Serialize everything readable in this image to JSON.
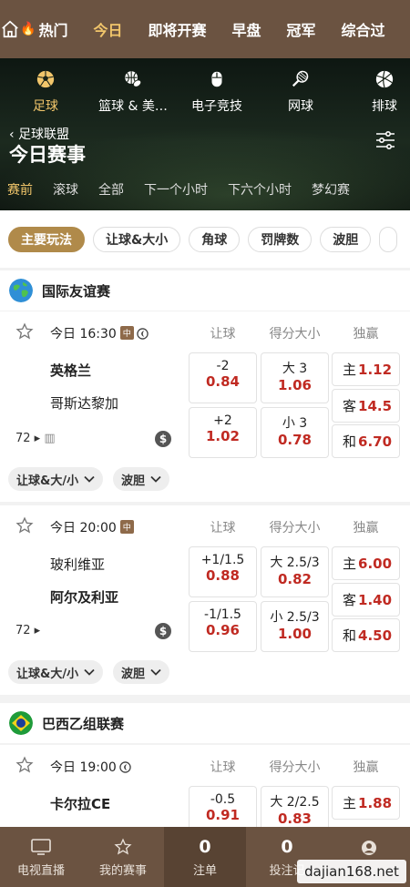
{
  "topnav": {
    "tabs": [
      "热门",
      "今日",
      "即将开赛",
      "早盘",
      "冠军",
      "综合过"
    ]
  },
  "sports": [
    {
      "label": "足球",
      "icon": "soccer-icon"
    },
    {
      "label": "篮球 & 美…",
      "icon": "basketball-icon"
    },
    {
      "label": "电子竞技",
      "icon": "esports-icon"
    },
    {
      "label": "网球",
      "icon": "tennis-icon"
    },
    {
      "label": "排球",
      "icon": "volleyball-icon"
    }
  ],
  "breadcrumb": "足球联盟",
  "page_title": "今日赛事",
  "subtabs": [
    "赛前",
    "滚球",
    "全部",
    "下一个小时",
    "下六个小时",
    "梦幻赛"
  ],
  "chips": [
    "主要玩法",
    "让球&大小",
    "角球",
    "罚牌数",
    "波胆"
  ],
  "columns": {
    "handicap": "让球",
    "totals": "得分大小",
    "winner": "独赢"
  },
  "leagues": [
    {
      "name": "国际友谊赛"
    },
    {
      "name": "巴西乙组联赛"
    }
  ],
  "matches": [
    {
      "time": "今日 16:30",
      "tag": "中",
      "home": "英格兰",
      "away": "哥斯达黎加",
      "more": "72",
      "handicap": [
        {
          "line": "-2",
          "odds": "0.84"
        },
        {
          "line": "+2",
          "odds": "1.02"
        }
      ],
      "totals": [
        {
          "line": "大 3",
          "odds": "1.06"
        },
        {
          "line": "小 3",
          "odds": "0.78"
        }
      ],
      "winner": [
        {
          "label": "主",
          "odds": "1.12"
        },
        {
          "label": "客",
          "odds": "14.5"
        },
        {
          "label": "和",
          "odds": "6.70"
        }
      ],
      "pills": [
        "让球&大/小",
        "波胆"
      ]
    },
    {
      "time": "今日 20:00",
      "tag": "中",
      "home": "玻利维亚",
      "away": "阿尔及利亚",
      "more": "72",
      "handicap": [
        {
          "line": "+1/1.5",
          "odds": "0.88"
        },
        {
          "line": "-1/1.5",
          "odds": "0.96"
        }
      ],
      "totals": [
        {
          "line": "大 2.5/3",
          "odds": "0.82"
        },
        {
          "line": "小 2.5/3",
          "odds": "1.00"
        }
      ],
      "winner": [
        {
          "label": "主",
          "odds": "6.00"
        },
        {
          "label": "客",
          "odds": "1.40"
        },
        {
          "label": "和",
          "odds": "4.50"
        }
      ],
      "pills": [
        "让球&大/小",
        "波胆"
      ]
    },
    {
      "time": "今日 19:00",
      "home": "卡尔拉CE",
      "handicap": [
        {
          "line": "-0.5",
          "odds": "0.91"
        }
      ],
      "totals": [
        {
          "line": "大 2/2.5",
          "odds": "0.83"
        }
      ],
      "winner": [
        {
          "label": "主",
          "odds": "1.88"
        }
      ]
    }
  ],
  "bottombar": {
    "items": [
      {
        "label": "电视直播",
        "icon": "tv-icon"
      },
      {
        "label": "我的赛事",
        "icon": "star-icon"
      },
      {
        "label": "注单",
        "count": "0"
      },
      {
        "label": "投注记",
        "count": "0"
      },
      {
        "label": "",
        "icon": "user-icon"
      }
    ]
  },
  "watermark": "dajian168.net",
  "colors": {
    "brand": "#6b5341",
    "accent": "#f2c66b",
    "odds": "#c02a22",
    "chip_active": "#b08a4a"
  }
}
